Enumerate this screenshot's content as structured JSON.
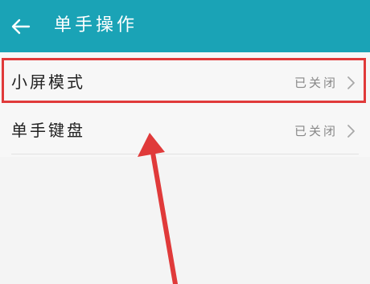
{
  "header": {
    "title": "单手操作",
    "back_icon": "back-arrow-icon",
    "background_color": "#1aa3b6"
  },
  "settings": {
    "items": [
      {
        "label": "小屏模式",
        "status": "已关闭",
        "chevron_icon": "chevron-right-icon"
      },
      {
        "label": "单手键盘",
        "status": "已关闭",
        "chevron_icon": "chevron-right-icon"
      }
    ]
  },
  "annotation": {
    "highlight_color": "#e03a3a",
    "arrow_icon": "red-arrow-icon"
  }
}
